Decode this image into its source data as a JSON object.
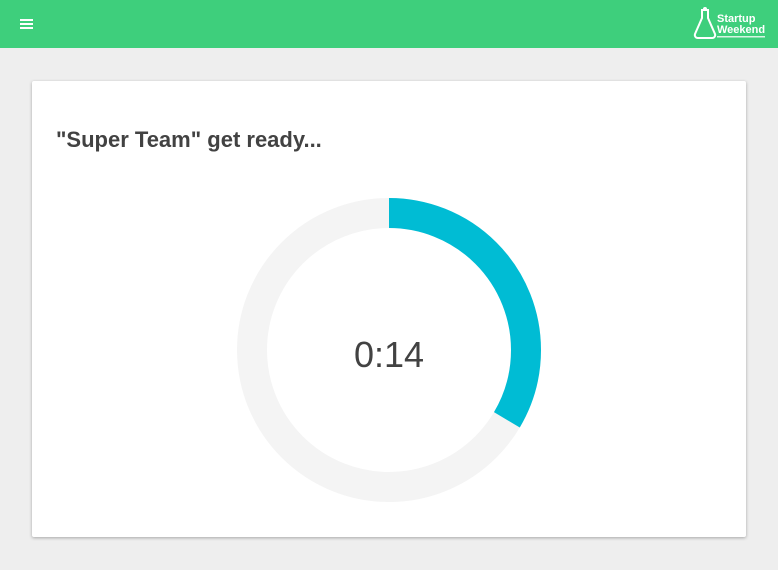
{
  "header": {
    "menu_icon": "hamburger-menu-icon",
    "logo_text": "Startup Weekend",
    "color": "#3ecf7c"
  },
  "card": {
    "title": "\"Super Team\" get ready...",
    "timer": {
      "time": "0:14",
      "progress": 0.335,
      "track_color": "#f4f4f4",
      "progress_color": "#00bcd4"
    }
  }
}
